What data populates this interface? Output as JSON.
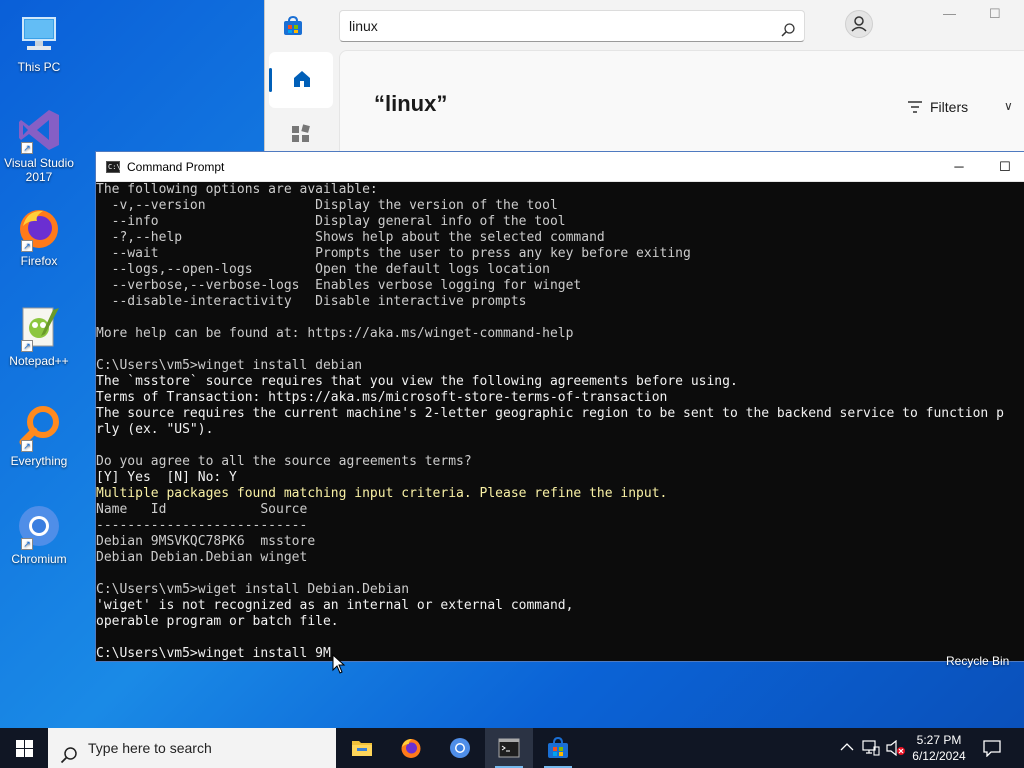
{
  "desktop": {
    "icons": [
      {
        "label": "This PC"
      },
      {
        "label": "Visual Studio 2017"
      },
      {
        "label": "Firefox"
      },
      {
        "label": "Notepad++"
      },
      {
        "label": "Everything"
      },
      {
        "label": "Chromium"
      }
    ],
    "recycle_label": "Recycle Bin"
  },
  "store": {
    "search_value": "linux",
    "query_title": "“linux”",
    "filters_label": "Filters",
    "minimize": "—",
    "maximize": "☐"
  },
  "cmd": {
    "title": "Command Prompt",
    "lines": [
      {
        "text": "The following options are available:",
        "style": "normal"
      },
      {
        "text": "  -v,--version              Display the version of the tool",
        "style": "normal"
      },
      {
        "text": "  --info                    Display general info of the tool",
        "style": "normal"
      },
      {
        "text": "  -?,--help                 Shows help about the selected command",
        "style": "normal"
      },
      {
        "text": "  --wait                    Prompts the user to press any key before exiting",
        "style": "normal"
      },
      {
        "text": "  --logs,--open-logs        Open the default logs location",
        "style": "normal"
      },
      {
        "text": "  --verbose,--verbose-logs  Enables verbose logging for winget",
        "style": "normal"
      },
      {
        "text": "  --disable-interactivity   Disable interactive prompts",
        "style": "normal"
      },
      {
        "text": "",
        "style": "normal"
      },
      {
        "text": "More help can be found at: https://aka.ms/winget-command-help",
        "style": "normal"
      },
      {
        "text": "",
        "style": "normal"
      },
      {
        "text": "C:\\Users\\vm5>winget install debian",
        "style": "normal"
      },
      {
        "text": "The `msstore` source requires that you view the following agreements before using.",
        "style": "bright"
      },
      {
        "text": "Terms of Transaction: https://aka.ms/microsoft-store-terms-of-transaction",
        "style": "bright"
      },
      {
        "text": "The source requires the current machine's 2-letter geographic region to be sent to the backend service to function p",
        "style": "bright"
      },
      {
        "text": "rly (ex. \"US\").",
        "style": "bright"
      },
      {
        "text": "",
        "style": "normal"
      },
      {
        "text": "Do you agree to all the source agreements terms?",
        "style": "normal"
      },
      {
        "text": "[Y] Yes  [N] No: Y",
        "style": "bright"
      },
      {
        "text": "Multiple packages found matching input criteria. Please refine the input.",
        "style": "yellow"
      },
      {
        "text": "Name   Id            Source",
        "style": "normal"
      },
      {
        "text": "---------------------------",
        "style": "normal"
      },
      {
        "text": "Debian 9MSVKQC78PK6  msstore",
        "style": "normal"
      },
      {
        "text": "Debian Debian.Debian winget",
        "style": "normal"
      },
      {
        "text": "",
        "style": "normal"
      },
      {
        "text": "C:\\Users\\vm5>wiget install Debian.Debian",
        "style": "normal"
      },
      {
        "text": "'wiget' is not recognized as an internal or external command,",
        "style": "bright"
      },
      {
        "text": "operable program or batch file.",
        "style": "bright"
      },
      {
        "text": "",
        "style": "normal"
      },
      {
        "text": "C:\\Users\\vm5>winget install 9M",
        "style": "bright"
      }
    ]
  },
  "taskbar": {
    "search_placeholder": "Type here to search",
    "time": "5:27 PM",
    "date": "6/12/2024"
  },
  "colors": {
    "desktop_blue": "#0a5fd8",
    "console_text": "#cccccc",
    "console_yellow": "#f9f1a5",
    "taskbar": "#101624",
    "accent": "#005fb8"
  }
}
